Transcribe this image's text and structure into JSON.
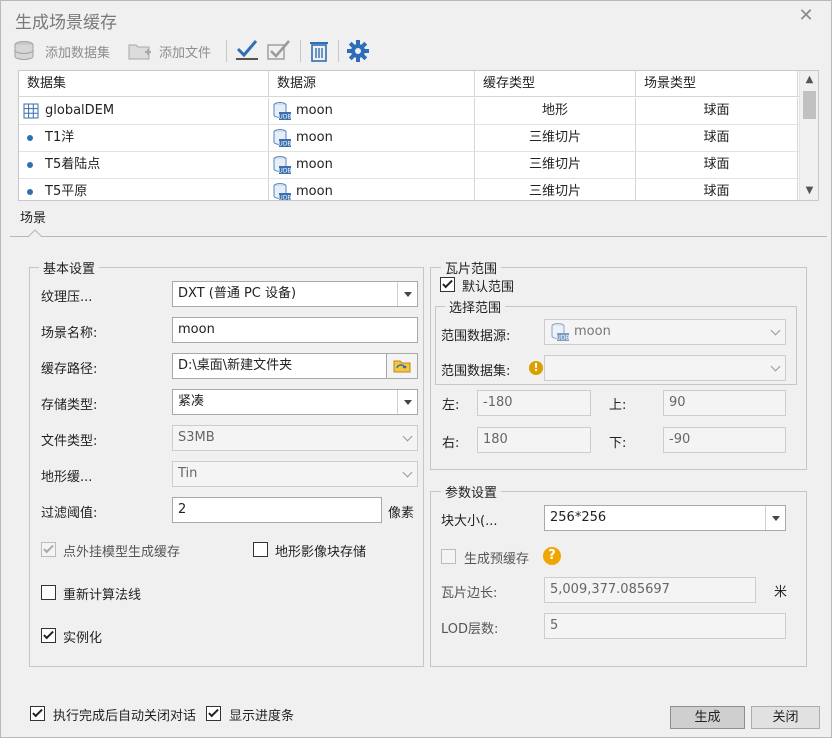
{
  "window": {
    "title": "生成场景缓存"
  },
  "toolbar": {
    "add_dataset": "添加数据集",
    "add_file": "添加文件"
  },
  "table": {
    "headers": [
      "数据集",
      "数据源",
      "缓存类型",
      "场景类型"
    ],
    "rows": [
      {
        "dataset": "globalDEM",
        "datasource": "moon",
        "cache_type": "地形",
        "scene_type": "球面",
        "icon": "grid-icon"
      },
      {
        "dataset": "T1洋",
        "datasource": "moon",
        "cache_type": "三维切片",
        "scene_type": "球面",
        "icon": "point-icon"
      },
      {
        "dataset": "T5着陆点",
        "datasource": "moon",
        "cache_type": "三维切片",
        "scene_type": "球面",
        "icon": "point-icon"
      },
      {
        "dataset": "T5平原",
        "datasource": "moon",
        "cache_type": "三维切片",
        "scene_type": "球面",
        "icon": "point-icon"
      }
    ]
  },
  "tabs": {
    "scene": "场景"
  },
  "basic": {
    "title": "基本设置",
    "texture_label": "纹理压...",
    "texture_value": "DXT (普通 PC 设备)",
    "scene_name_label": "场景名称:",
    "scene_name_value": "moon",
    "cache_path_label": "缓存路径:",
    "cache_path_value": "D:\\桌面\\新建文件夹",
    "storage_label": "存储类型:",
    "storage_value": "紧凑",
    "file_type_label": "文件类型:",
    "file_type_value": "S3MB",
    "terrain_label": "地形缓...",
    "terrain_value": "Tin",
    "filter_label": "过滤阈值:",
    "filter_value": "2",
    "filter_unit": "像素",
    "cb_outer_model": "点外挂模型生成缓存",
    "cb_terrain_image": "地形影像块存储",
    "cb_recalc_normal": "重新计算法线",
    "cb_instancing": "实例化"
  },
  "tile_range": {
    "title": "瓦片范围",
    "cb_default": "默认范围",
    "select_title": "选择范围",
    "range_ds_label": "范围数据源:",
    "range_ds_value": "moon",
    "range_set_label": "范围数据集:",
    "left_label": "左:",
    "left_value": "-180",
    "top_label": "上:",
    "top_value": "90",
    "right_label": "右:",
    "right_value": "180",
    "bottom_label": "下:",
    "bottom_value": "-90"
  },
  "params": {
    "title": "参数设置",
    "block_label": "块大小(...",
    "block_value": "256*256",
    "cb_precache": "生成预缓存",
    "tile_len_label": "瓦片边长:",
    "tile_len_value": "5,009,377.085697",
    "tile_len_unit": "米",
    "lod_label": "LOD层数:",
    "lod_value": "5"
  },
  "footer": {
    "cb_autoclose": "执行完成后自动关闭对话",
    "cb_progress": "显示进度条",
    "generate": "生成",
    "close": "关闭"
  },
  "colors": {
    "accent": "#2f6fb5",
    "gear": "#2d6db8",
    "help": "#f0a500"
  }
}
